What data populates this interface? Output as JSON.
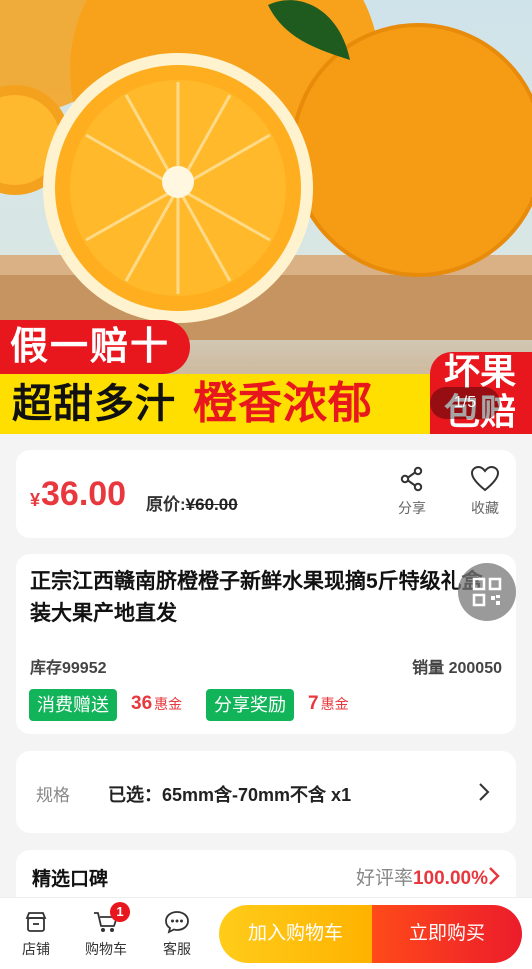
{
  "hero": {
    "badge_fake": "假一赔十",
    "slogan_left": "超甜多汁",
    "slogan_right": "橙香浓郁",
    "bad_fruit_line1": "坏果",
    "bad_fruit_line2": "包赔",
    "pager": "1/5"
  },
  "price": {
    "currency": "¥",
    "current": "36.00",
    "original_label": "原价:",
    "original": "¥60.00"
  },
  "actions": {
    "share": "分享",
    "favorite": "收藏"
  },
  "product": {
    "title": "正宗江西赣南脐橙橙子新鲜水果现摘5斤特级礼盒装大果产地直发",
    "stock": "库存99952",
    "sales": "销量 200050"
  },
  "rewards": [
    {
      "label": "消费赠送",
      "amount": "36",
      "unit": "惠金"
    },
    {
      "label": "分享奖励",
      "amount": "7",
      "unit": "惠金"
    }
  ],
  "spec": {
    "label": "规格",
    "value": "已选：65mm含-70mm不含 x1"
  },
  "reviews": {
    "title": "精选口碑",
    "rate_label": "好评率",
    "rate_value": "100.00%"
  },
  "bottom_nav": {
    "store": "店铺",
    "cart": "购物车",
    "cart_count": "1",
    "service": "客服",
    "add_to_cart": "加入购物车",
    "buy_now": "立即购买"
  },
  "colors": {
    "accent_red": "#e8383d",
    "reward_green": "#12b45a",
    "cart_yellow": "#ffb200",
    "buy_red": "#ec1c2b"
  },
  "icons": [
    "share-icon",
    "heart-icon",
    "qr-code-icon",
    "chevron-right-icon",
    "store-icon",
    "cart-icon",
    "chat-icon"
  ]
}
